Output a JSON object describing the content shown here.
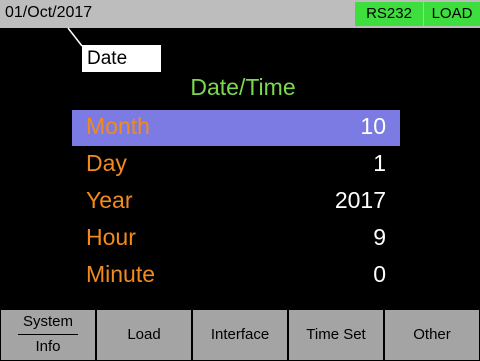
{
  "status_bar": {
    "date": "01/Oct/2017",
    "interface": "RS232",
    "mode": "LOAD",
    "colors": {
      "background": "#bdbdbd",
      "badge": "#3dde3d"
    }
  },
  "callout": {
    "label": "Date"
  },
  "title": "Date/Time",
  "fields": [
    {
      "label": "Month",
      "value": "10",
      "selected": true
    },
    {
      "label": "Day",
      "value": "1",
      "selected": false
    },
    {
      "label": "Year",
      "value": "2017",
      "selected": false
    },
    {
      "label": "Hour",
      "value": "9",
      "selected": false
    },
    {
      "label": "Minute",
      "value": "0",
      "selected": false
    }
  ],
  "softkeys": {
    "system_info": {
      "line1": "System",
      "line2": "Info"
    },
    "load": "Load",
    "interface": "Interface",
    "time_set": "Time Set",
    "other": "Other"
  },
  "colors": {
    "title": "#7cd84e",
    "field_label": "#f28a1e",
    "field_value": "#ffffff",
    "selection": "#7b7be3",
    "softkey": "#a4a4a4"
  }
}
